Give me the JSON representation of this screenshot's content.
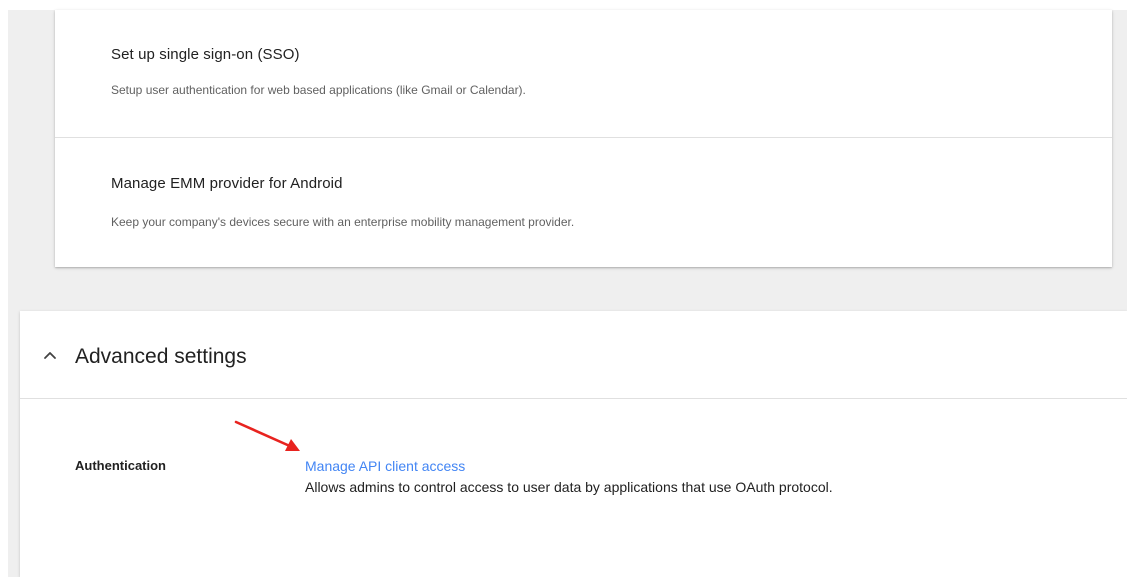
{
  "security_card": {
    "items": [
      {
        "title": "Set up single sign-on (SSO)",
        "description": "Setup user authentication for web based applications (like Gmail or Calendar)."
      },
      {
        "title": "Manage EMM provider for Android",
        "description": "Keep your company's devices secure with an enterprise mobility management provider."
      }
    ]
  },
  "advanced_settings": {
    "title": "Advanced settings",
    "expanded": true,
    "toggle_icon": "chevron-up-icon",
    "authentication": {
      "label": "Authentication",
      "link_text": "Manage API client access",
      "link_description": "Allows admins to control access to user data by applications that use OAuth protocol."
    }
  },
  "annotation": {
    "icon": "red-arrow-icon",
    "color": "#e8231f"
  },
  "colors": {
    "link": "#4285f4",
    "background": "#efefef",
    "text_primary": "#212121",
    "text_secondary": "#616161"
  }
}
